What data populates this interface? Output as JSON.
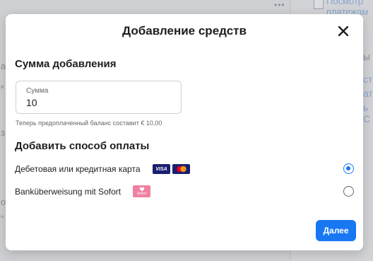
{
  "background": {
    "right_links": [
      "Посмотр",
      "платежам"
    ],
    "right_side_text": "ы",
    "fragments_left": [
      "а",
      "и",
      "з",
      "о",
      "ч"
    ],
    "fragments_right_blue": [
      "ста",
      "ат",
      "ь С"
    ],
    "dots": "•••"
  },
  "modal": {
    "title": "Добавление средств",
    "close_icon": "close-icon",
    "amount_section_title": "Сумма добавления",
    "amount_field": {
      "label": "Сумма",
      "value": "10"
    },
    "balance_note": "Теперь предоплаченный баланс составит € 10,00",
    "payment_section_title": "Добавить способ оплаты",
    "payment_methods": [
      {
        "label": "Дебетовая или кредитная карта",
        "icons": [
          "visa-icon",
          "mastercard-icon"
        ],
        "visa_text": "VISA",
        "selected": true
      },
      {
        "label": "Banküberweisung mit Sofort",
        "icons": [
          "sofort-icon"
        ],
        "sofort_text": "Sofort",
        "selected": false
      }
    ],
    "next_button": "Далее"
  },
  "colors": {
    "accent": "#1877f2",
    "overlay": "#c7c8cb",
    "sofort_pink": "#ef809f",
    "visa_navy": "#1a1f71",
    "mastercard_red": "#eb001b",
    "mastercard_orange": "#f79e1b"
  }
}
